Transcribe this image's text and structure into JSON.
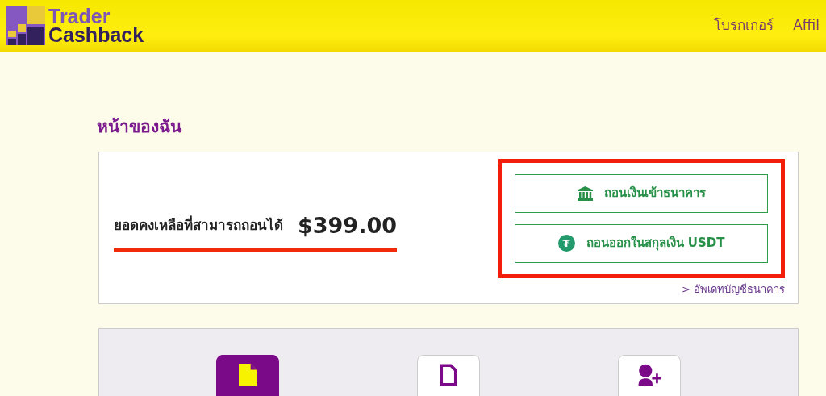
{
  "header": {
    "logo_line1": "Trader",
    "logo_line2": "Cashback",
    "nav": [
      {
        "label": "โบรกเกอร์"
      },
      {
        "label": "Affil"
      }
    ]
  },
  "page_title": "หน้าของฉัน",
  "balance": {
    "label": "ยอดคงเหลือที่สามารถถอนได้",
    "amount": "$399.00",
    "highlighted": true
  },
  "withdraw_buttons": [
    {
      "kind": "bank",
      "label": "ถอนเงินเข้าธนาคาร"
    },
    {
      "kind": "usdt",
      "label": "ถอนออกในสกุลเงิน USDT",
      "symbol": "₮"
    }
  ],
  "buttons_highlighted": true,
  "update_link": {
    "arrow": ">",
    "label": "อัพเดทบัญชีธนาคาร"
  },
  "tiles": [
    {
      "kind": "file",
      "selected": true
    },
    {
      "kind": "file",
      "selected": false
    },
    {
      "kind": "add-user",
      "selected": false
    }
  ]
}
